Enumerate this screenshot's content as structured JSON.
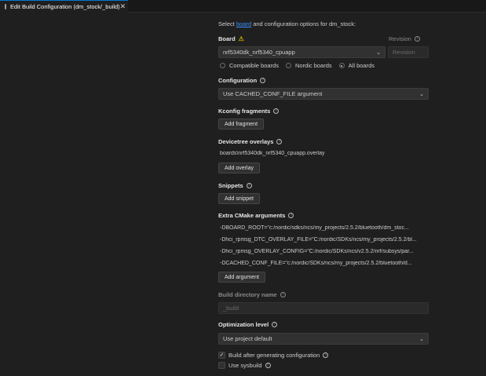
{
  "tab": {
    "title": "Edit Build Configuration (dm_stock/_build)",
    "close": "✕"
  },
  "intro": {
    "prefix": "Select ",
    "link": "board",
    "suffix": " and configuration options for dm_stock:"
  },
  "board": {
    "label": "Board",
    "value": "nrf5340dk_nrf5340_cpuapp",
    "options": [
      "Compatible boards",
      "Nordic boards",
      "All boards"
    ],
    "selected_option": "All boards"
  },
  "revision": {
    "label": "Revision",
    "placeholder": "Revision"
  },
  "configuration": {
    "label": "Configuration",
    "value": "Use CACHED_CONF_FILE argument"
  },
  "kconfig": {
    "label": "Kconfig fragments",
    "button": "Add fragment"
  },
  "devicetree": {
    "label": "Devicetree overlays",
    "items": [
      "boards\\nrf5340dk_nrf5340_cpuapp.overlay"
    ],
    "button": "Add overlay"
  },
  "snippets": {
    "label": "Snippets",
    "button": "Add snippet"
  },
  "cmake": {
    "label": "Extra CMake arguments",
    "items": [
      "-DBOARD_ROOT=\"c:/nordic/sdks/ncs/my_projects/2.5.2/bluetooth/dm_stoc...",
      "-Dhci_rpmsg_DTC_OVERLAY_FILE=\"C:/nordic/SDKs/ncs/my_projects/2.5.2/bl...",
      "-Dhci_rpmsg_OVERLAY_CONFIG=\"C:/nordic/SDKs/ncs/v2.5.2/nrf/subsys/par...",
      "-DCACHED_CONF_FILE=\"c:/nordic/SDKs/ncs/my_projects/2.5.2/bluetooth/d..."
    ],
    "button": "Add argument"
  },
  "build_dir": {
    "label": "Build directory name",
    "placeholder": "_build"
  },
  "optimization": {
    "label": "Optimization level",
    "value": "Use project default"
  },
  "options": {
    "build_after": {
      "label": "Build after generating configuration",
      "checked": true
    },
    "sysbuild": {
      "label": "Use sysbuild",
      "checked": false
    }
  },
  "colors": {
    "accent": "#0078d4",
    "link": "#3794ff",
    "warning": "#cca700",
    "background": "#1f1f1f"
  }
}
